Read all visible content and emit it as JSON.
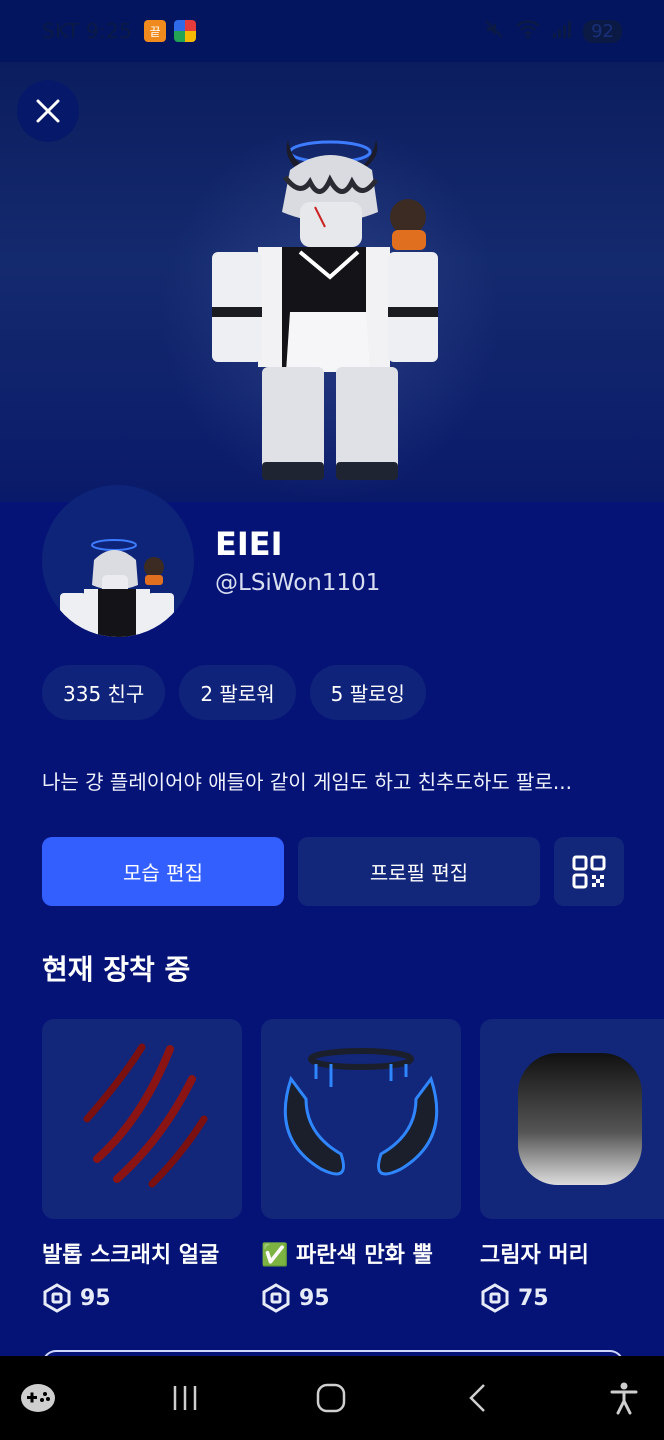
{
  "status_bar": {
    "time": "SKT 9:25",
    "app_badge_1": "끝",
    "battery": "92"
  },
  "profile": {
    "display_name": "EIEI",
    "username": "@LSiWon1101",
    "stats": [
      {
        "label": "335 친구"
      },
      {
        "label": "2 팔로워"
      },
      {
        "label": "5 팔로잉"
      }
    ],
    "bio": "나는 걍 플레이어야 애들아 같이 게임도 하고 친추도하도 팔로..."
  },
  "actions": {
    "edit_avatar": "모습 편집",
    "edit_profile": "프로필 편집"
  },
  "section": {
    "wearing_title": "현재 장착 중"
  },
  "items": [
    {
      "name": "발톱 스크래치 얼굴",
      "price": "95",
      "thumb_icon": "claw-scratch-icon"
    },
    {
      "name": "✅ 파란색 만화 뿔",
      "price": "95",
      "thumb_icon": "blue-horns-icon"
    },
    {
      "name": "그림자 머리",
      "price": "75",
      "thumb_icon": "shadow-head-icon"
    }
  ],
  "colors": {
    "background": "#051377",
    "primary_button": "#335fff",
    "secondary_button": "#12267a"
  }
}
